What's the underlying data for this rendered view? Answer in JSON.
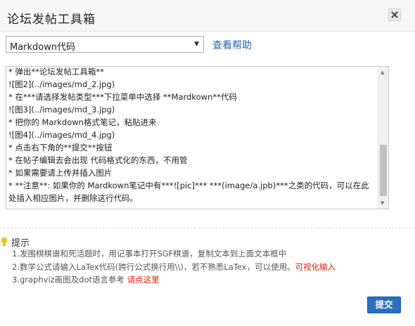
{
  "dialog": {
    "title": "论坛发帖工具箱"
  },
  "toolbar": {
    "select_value": "Markdown代码",
    "help_link": "查看帮助"
  },
  "editor": {
    "lines": [
      "* 弹出**论坛发帖工具箱**",
      "![图2](../images/md_2.jpg)",
      "* 在***请选择发帖类型***下拉菜单中选择 **Mardkown**代码",
      "![图3](../images/md_3.jpg)",
      "* 把你的 Markdown格式笔记，粘贴进来",
      "![图4](../images/md_4.jpg)",
      "* 点击右下角的**提交**按钮",
      "* 在帖子编辑去会出现 代码格式化的东西，不用管",
      "* 如果需要请上传并插入图片",
      "  * **注意**: 如果你的 Mardkown笔记中有***![pic]*** ***(image/a.jpb)***之类的代码，可以在此处插入相应图片，并删除这行代码。"
    ]
  },
  "tips": {
    "title": "提示",
    "line1": "1.发围棋棋谱和死活题时，用记事本打开SGF棋谱，复制文本到上面文本框中",
    "line2_text": "2.数学公式请输入LaTex代码(跨行公式换行用\\\\)，若不熟悉LaTex，可以使用。",
    "line2_link": "可视化输入",
    "line3_text": "3.graphviz画图及dot语言参考 ",
    "line3_link": "请点这里"
  },
  "actions": {
    "submit_label": "提交"
  },
  "colors": {
    "link_blue": "#2a5fae",
    "link_red": "#d81e06",
    "submit_bg": "#2a6fbe"
  },
  "icons": {
    "close": "close-icon",
    "dropdown": "chevron-down-icon",
    "tips": "lightbulb-icon"
  }
}
